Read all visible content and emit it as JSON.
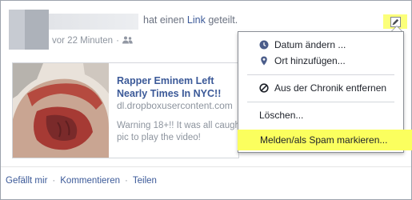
{
  "story": {
    "headline_prefix": "hat einen ",
    "headline_link": "Link",
    "headline_suffix": " geteilt.",
    "timestamp": "vor 22 Minuten",
    "dot": "·"
  },
  "share": {
    "title": "Rapper Eminem Left Nearly Times In NYC!!",
    "domain": "dl.dropboxusercontent.com",
    "description": "Warning 18+!! It was all caught pic to play the video!"
  },
  "menu": {
    "items": [
      {
        "label": "Datum ändern ...",
        "icon": "clock-icon"
      },
      {
        "label": "Ort hinzufügen...",
        "icon": "location-pin-icon"
      },
      {
        "label": "Aus der Chronik entfernen",
        "icon": "block-icon"
      },
      {
        "label": "Löschen...",
        "icon": ""
      },
      {
        "label": "Melden/als Spam markieren...",
        "icon": ""
      }
    ]
  },
  "actions": {
    "like": "Gefällt mir",
    "comment": "Kommentieren",
    "share": "Teilen",
    "dot": "·"
  },
  "colors": {
    "link": "#3b5998",
    "highlight": "#fbff5e",
    "meta_text": "#8d949e"
  }
}
